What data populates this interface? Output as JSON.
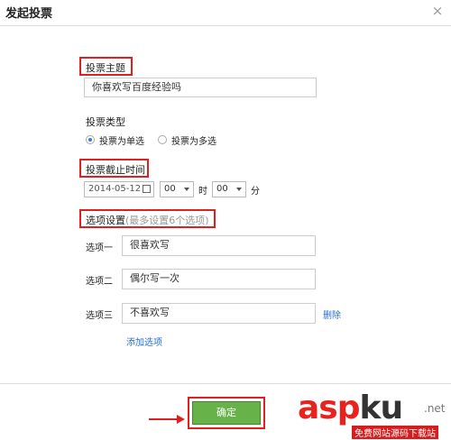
{
  "dialog": {
    "title": "发起投票",
    "close_icon": "close-icon"
  },
  "topic": {
    "label": "投票主题",
    "value": "你喜欢写百度经验吗"
  },
  "type": {
    "label": "投票类型",
    "options": [
      "投票为单选",
      "投票为多选"
    ],
    "selected": "投票为单选"
  },
  "deadline": {
    "label": "投票截止时间",
    "date": "2014-05-12",
    "hour": "00",
    "hour_unit": "时",
    "minute": "00",
    "minute_unit": "分"
  },
  "options_section": {
    "label": "选项设置",
    "hint": "(最多设置6个选项)"
  },
  "options": [
    {
      "label": "选项一",
      "value": "很喜欢写"
    },
    {
      "label": "选项二",
      "value": "偶尔写一次"
    },
    {
      "label": "选项三",
      "value": "不喜欢写",
      "delete_label": "删除"
    }
  ],
  "add_option_label": "添加选项",
  "confirm_button": "确定",
  "watermark": {
    "brand_red": "asp",
    "brand_dark": "ku",
    "suffix": ".net",
    "tagline": "免费网站源码下载站"
  },
  "colors": {
    "highlight": "#e02020",
    "confirm": "#67b34a",
    "link": "#2a6fd0"
  }
}
